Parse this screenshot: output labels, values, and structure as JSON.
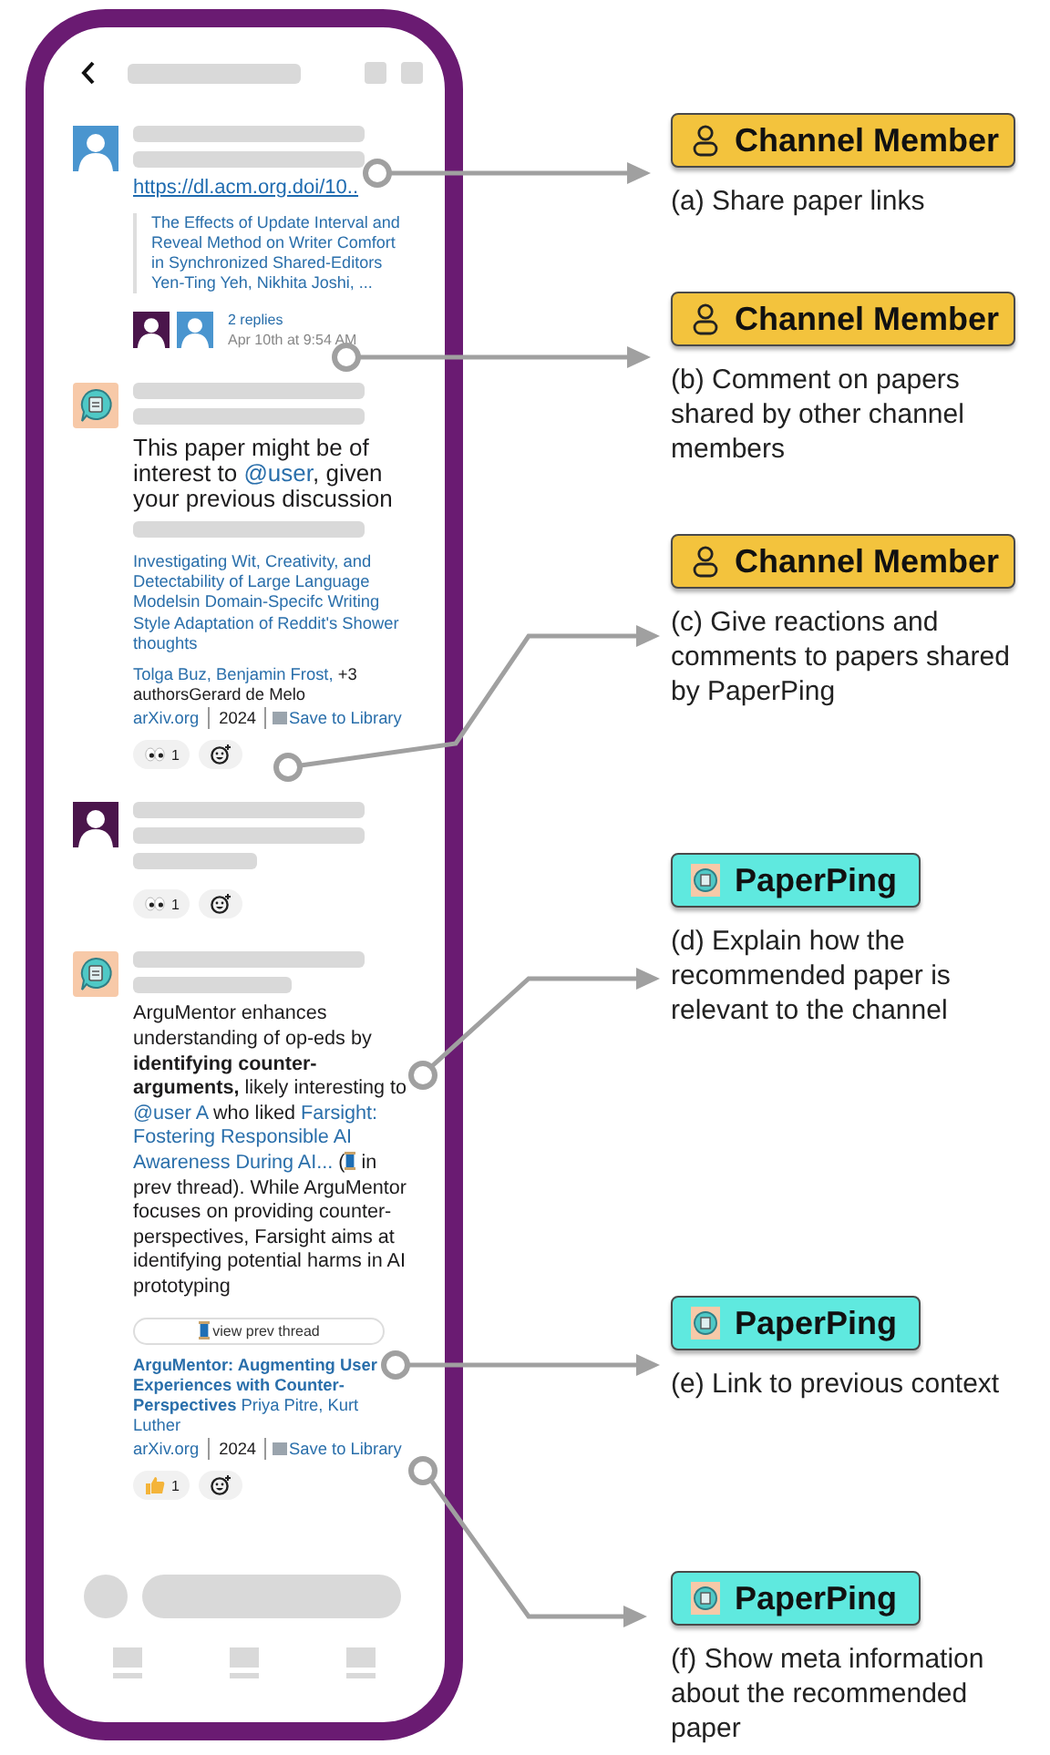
{
  "phone": {
    "messages": [
      {
        "kind": "share",
        "avatar": {
          "kind": "person",
          "color": "#4a95cf"
        },
        "link": "https://dl.acm.org.doi/10..",
        "preview": {
          "title": "The Effects of Update Interval and Reveal Method on Writer Comfort in Synchronized Shared-Editors",
          "authors": "Yen-Ting Yeh, Nikhita Joshi, ..."
        },
        "replies": {
          "avatars": [
            {
              "color": "#4a154b"
            },
            {
              "color": "#4a95cf"
            }
          ],
          "count": "2 replies",
          "time": "Apr 10th at 9:54 AM"
        }
      },
      {
        "kind": "recommendation",
        "avatar": {
          "kind": "bot"
        },
        "body": [
          {
            "kind": "text",
            "text": "This paper might be of interest to "
          },
          {
            "kind": "mention",
            "text": "@user"
          },
          {
            "kind": "text",
            "text": ", given your previous discussion"
          }
        ],
        "paper": {
          "title": "Investigating Wit, Creativity, and Detectability of Large Language Modelsin Domain-Specifc Writing Style Adaptation of Reddit's Shower thoughts",
          "title_bold": false,
          "authors": "Tolga Buz, Benjamin Frost,",
          "authors_more": "+3 authorsGerard de Melo",
          "venue": "arXiv.org",
          "year": "2024",
          "save": "Save to Library"
        },
        "reactions": [
          {
            "kind": "eyes",
            "count": "1"
          },
          {
            "kind": "add"
          }
        ]
      },
      {
        "kind": "comment",
        "avatar": {
          "kind": "person",
          "color": "#4a154b"
        },
        "reactions": [
          {
            "kind": "eyes",
            "count": "1"
          },
          {
            "kind": "add"
          }
        ]
      },
      {
        "kind": "explanation",
        "avatar": {
          "kind": "bot"
        },
        "body": [
          {
            "kind": "text",
            "text": "ArguMentor enhances understanding of op-eds by "
          },
          {
            "kind": "bold",
            "text": "identifying counter-arguments,"
          },
          {
            "kind": "text",
            "text": " likely interesting to "
          },
          {
            "kind": "mention",
            "text": "@user A"
          },
          {
            "kind": "text",
            "text": " who liked "
          },
          {
            "kind": "link",
            "text": "Farsight: Fostering Responsible AI Awareness During AI..."
          },
          {
            "kind": "text",
            "text": " ("
          },
          {
            "kind": "thread"
          },
          {
            "kind": "text",
            "text": " in prev thread). While ArguMentor focuses on providing counter-perspectives, Farsight aims at identifying potential harms in AI prototyping"
          }
        ],
        "button": "view prev thread",
        "paper": {
          "title": "ArguMentor: Augmenting User Experiences with Counter-Perspectives",
          "title_bold": true,
          "authors": "Priya Pitre, Kurt Luther",
          "venue": "arXiv.org",
          "year": "2024",
          "save": "Save to Library"
        },
        "reactions": [
          {
            "kind": "thumbs",
            "count": "1"
          },
          {
            "kind": "add"
          }
        ]
      }
    ]
  },
  "annotations": [
    {
      "kind": "member",
      "label": "Channel Member",
      "description": "(a) Share paper links"
    },
    {
      "kind": "member",
      "label": "Channel Member",
      "description": "(b) Comment on papers shared by other channel members"
    },
    {
      "kind": "member",
      "label": "Channel Member",
      "description": "(c) Give reactions and comments to papers shared by PaperPing"
    },
    {
      "kind": "bot",
      "label": "PaperPing",
      "description": "(d) Explain how the recommended paper is relevant to the channel"
    },
    {
      "kind": "bot",
      "label": "PaperPing",
      "description": "(e) Link to previous context"
    },
    {
      "kind": "bot",
      "label": "PaperPing",
      "description": "(f) Show meta information about the recommended paper"
    }
  ]
}
